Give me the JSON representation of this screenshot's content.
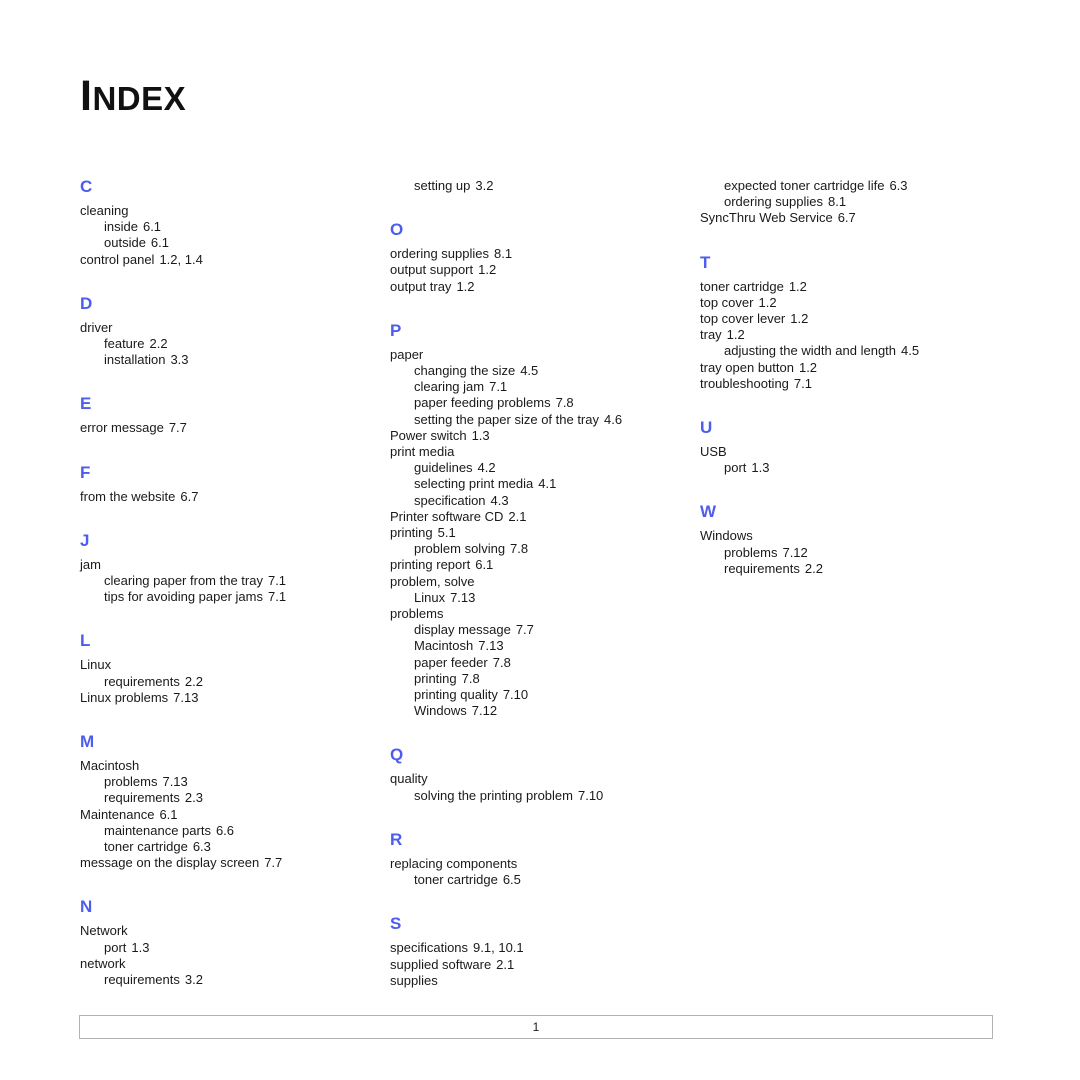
{
  "document": {
    "title_cap": "I",
    "title_rest": "NDEX",
    "title_full": "INDEX",
    "accent_color": "#4d5dee",
    "text_color": "#1a1a1a",
    "footer_border_color": "#b3b3b3"
  },
  "footer": {
    "page_number": "1"
  },
  "columns": [
    {
      "id": "column-1",
      "blocks": [
        {
          "type": "letter",
          "letter": "C",
          "entries": [
            {
              "level": 1,
              "text": "cleaning",
              "locator": ""
            },
            {
              "level": 2,
              "text": "inside",
              "locator": "6.1"
            },
            {
              "level": 2,
              "text": "outside",
              "locator": "6.1"
            },
            {
              "level": 1,
              "text": "control panel",
              "locator": "1.2,  1.4"
            }
          ]
        },
        {
          "type": "letter",
          "letter": "D",
          "entries": [
            {
              "level": 1,
              "text": "driver",
              "locator": ""
            },
            {
              "level": 2,
              "text": "feature",
              "locator": "2.2"
            },
            {
              "level": 2,
              "text": "installation",
              "locator": "3.3"
            }
          ]
        },
        {
          "type": "letter",
          "letter": "E",
          "entries": [
            {
              "level": 1,
              "text": "error message",
              "locator": "7.7"
            }
          ]
        },
        {
          "type": "letter",
          "letter": "F",
          "entries": [
            {
              "level": 1,
              "text": "from the website",
              "locator": "6.7"
            }
          ]
        },
        {
          "type": "letter",
          "letter": "J",
          "entries": [
            {
              "level": 1,
              "text": "jam",
              "locator": ""
            },
            {
              "level": 2,
              "text": "clearing paper from the tray",
              "locator": "7.1"
            },
            {
              "level": 2,
              "text": "tips for avoiding paper jams",
              "locator": "7.1"
            }
          ]
        },
        {
          "type": "letter",
          "letter": "L",
          "entries": [
            {
              "level": 1,
              "text": "Linux",
              "locator": ""
            },
            {
              "level": 2,
              "text": "requirements",
              "locator": "2.2"
            },
            {
              "level": 1,
              "text": "Linux problems",
              "locator": "7.13"
            }
          ]
        },
        {
          "type": "letter",
          "letter": "M",
          "entries": [
            {
              "level": 1,
              "text": "Macintosh",
              "locator": ""
            },
            {
              "level": 2,
              "text": "problems",
              "locator": "7.13"
            },
            {
              "level": 2,
              "text": "requirements",
              "locator": "2.3"
            },
            {
              "level": 1,
              "text": "Maintenance",
              "locator": "6.1"
            },
            {
              "level": 2,
              "text": "maintenance parts",
              "locator": "6.6"
            },
            {
              "level": 2,
              "text": "toner cartridge",
              "locator": "6.3"
            },
            {
              "level": 1,
              "text": "message on the display screen",
              "locator": "7.7"
            }
          ]
        },
        {
          "type": "letter",
          "letter": "N",
          "entries": [
            {
              "level": 1,
              "text": "Network",
              "locator": ""
            },
            {
              "level": 2,
              "text": "port",
              "locator": "1.3"
            },
            {
              "level": 1,
              "text": "network",
              "locator": ""
            },
            {
              "level": 2,
              "text": "requirements",
              "locator": "3.2"
            }
          ]
        }
      ]
    },
    {
      "id": "column-2",
      "blocks": [
        {
          "type": "continuation",
          "letter": "",
          "entries": [
            {
              "level": 2,
              "text": "setting up",
              "locator": "3.2"
            }
          ]
        },
        {
          "type": "letter",
          "letter": "O",
          "entries": [
            {
              "level": 1,
              "text": "ordering supplies",
              "locator": "8.1"
            },
            {
              "level": 1,
              "text": "output support",
              "locator": "1.2"
            },
            {
              "level": 1,
              "text": "output tray",
              "locator": "1.2"
            }
          ]
        },
        {
          "type": "letter",
          "letter": "P",
          "entries": [
            {
              "level": 1,
              "text": "paper",
              "locator": ""
            },
            {
              "level": 2,
              "text": "changing the size",
              "locator": "4.5"
            },
            {
              "level": 2,
              "text": "clearing jam",
              "locator": "7.1"
            },
            {
              "level": 2,
              "text": "paper feeding problems",
              "locator": "7.8"
            },
            {
              "level": 2,
              "text": "setting the paper size of the tray",
              "locator": "4.6"
            },
            {
              "level": 1,
              "text": "Power switch",
              "locator": "1.3"
            },
            {
              "level": 1,
              "text": "print media",
              "locator": ""
            },
            {
              "level": 2,
              "text": "guidelines",
              "locator": "4.2"
            },
            {
              "level": 2,
              "text": "selecting print media",
              "locator": "4.1"
            },
            {
              "level": 2,
              "text": "specification",
              "locator": "4.3"
            },
            {
              "level": 1,
              "text": "Printer software CD",
              "locator": "2.1"
            },
            {
              "level": 1,
              "text": "printing",
              "locator": "5.1"
            },
            {
              "level": 2,
              "text": "problem solving",
              "locator": "7.8"
            },
            {
              "level": 1,
              "text": "printing report",
              "locator": "6.1"
            },
            {
              "level": 1,
              "text": "problem, solve",
              "locator": ""
            },
            {
              "level": 2,
              "text": "Linux",
              "locator": "7.13"
            },
            {
              "level": 1,
              "text": "problems",
              "locator": ""
            },
            {
              "level": 2,
              "text": "display message",
              "locator": "7.7"
            },
            {
              "level": 2,
              "text": "Macintosh",
              "locator": "7.13"
            },
            {
              "level": 2,
              "text": "paper feeder",
              "locator": "7.8"
            },
            {
              "level": 2,
              "text": "printing",
              "locator": "7.8"
            },
            {
              "level": 2,
              "text": "printing quality",
              "locator": "7.10"
            },
            {
              "level": 2,
              "text": "Windows",
              "locator": "7.12"
            }
          ]
        },
        {
          "type": "letter",
          "letter": "Q",
          "entries": [
            {
              "level": 1,
              "text": "quality",
              "locator": ""
            },
            {
              "level": 2,
              "text": "solving the printing problem",
              "locator": "7.10"
            }
          ]
        },
        {
          "type": "letter",
          "letter": "R",
          "entries": [
            {
              "level": 1,
              "text": "replacing components",
              "locator": ""
            },
            {
              "level": 2,
              "text": "toner cartridge",
              "locator": "6.5"
            }
          ]
        },
        {
          "type": "letter",
          "letter": "S",
          "entries": [
            {
              "level": 1,
              "text": "specifications",
              "locator": "9.1,  10.1"
            },
            {
              "level": 1,
              "text": "supplied software",
              "locator": "2.1"
            },
            {
              "level": 1,
              "text": "supplies",
              "locator": ""
            }
          ]
        }
      ]
    },
    {
      "id": "column-3",
      "blocks": [
        {
          "type": "continuation",
          "letter": "",
          "entries": [
            {
              "level": 2,
              "text": "expected toner cartridge life",
              "locator": "6.3"
            },
            {
              "level": 2,
              "text": "ordering supplies",
              "locator": "8.1"
            },
            {
              "level": 1,
              "text": "SyncThru Web Service",
              "locator": "6.7"
            }
          ]
        },
        {
          "type": "letter",
          "letter": "T",
          "entries": [
            {
              "level": 1,
              "text": "toner cartridge",
              "locator": "1.2"
            },
            {
              "level": 1,
              "text": "top cover",
              "locator": "1.2"
            },
            {
              "level": 1,
              "text": "top cover lever",
              "locator": "1.2"
            },
            {
              "level": 1,
              "text": "tray",
              "locator": "1.2"
            },
            {
              "level": 2,
              "text": "adjusting the width and length",
              "locator": "4.5"
            },
            {
              "level": 1,
              "text": "tray open button",
              "locator": "1.2"
            },
            {
              "level": 1,
              "text": "troubleshooting",
              "locator": "7.1"
            }
          ]
        },
        {
          "type": "letter",
          "letter": "U",
          "entries": [
            {
              "level": 1,
              "text": "USB",
              "locator": ""
            },
            {
              "level": 2,
              "text": "port",
              "locator": "1.3"
            }
          ]
        },
        {
          "type": "letter",
          "letter": "W",
          "entries": [
            {
              "level": 1,
              "text": "Windows",
              "locator": ""
            },
            {
              "level": 2,
              "text": "problems",
              "locator": "7.12"
            },
            {
              "level": 2,
              "text": "requirements",
              "locator": "2.2"
            }
          ]
        }
      ]
    }
  ]
}
